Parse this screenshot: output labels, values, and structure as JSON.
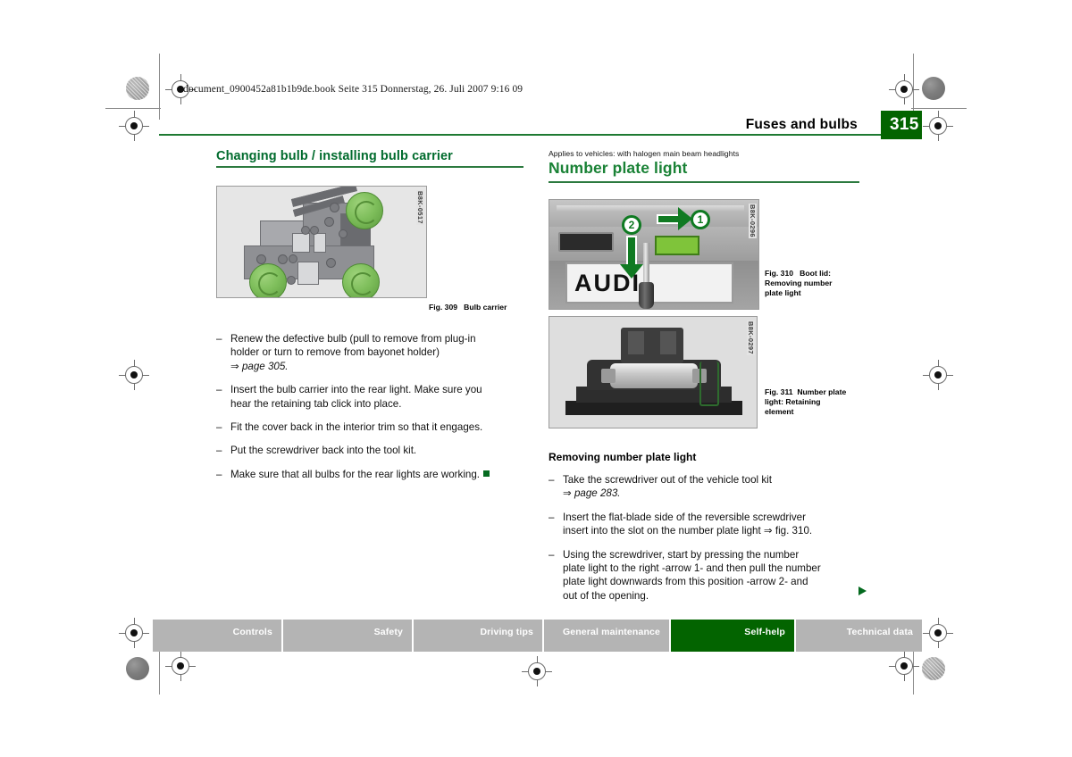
{
  "doc_header": "document_0900452a81b1b9de.book  Seite 315  Donnerstag, 26. Juli 2007  9:16 09",
  "running_head": {
    "title": "Fuses and bulbs",
    "page_number": "315"
  },
  "colors": {
    "green_rule": "#2c7a3f",
    "heading_green": "#1a8236",
    "page_tab_green": "#036400",
    "tab_grey": "#b4b4b4"
  },
  "left_column": {
    "heading": "Changing bulb / installing bulb carrier",
    "figure": {
      "code": "B8K-0517",
      "caption_number": "Fig. 309",
      "caption_text": "Bulb carrier"
    },
    "items": [
      {
        "dash": "–",
        "line1": "Renew the defective bulb (pull to remove from plug-in",
        "line2": "holder or turn to remove from bayonet holder)",
        "ref_arrow": "⇒",
        "ref_text": "page 305.",
        "end_marker": false
      },
      {
        "dash": "–",
        "line1": "Insert the bulb carrier into the rear light. Make sure you",
        "line2": "hear the retaining tab click into place.",
        "ref_arrow": "",
        "ref_text": "",
        "end_marker": false
      },
      {
        "dash": "–",
        "line1": "Fit the cover back in the interior trim so that it engages.",
        "line2": "",
        "ref_arrow": "",
        "ref_text": "",
        "end_marker": false
      },
      {
        "dash": "–",
        "line1": "Put the screwdriver back into the tool kit.",
        "line2": "",
        "ref_arrow": "",
        "ref_text": "",
        "end_marker": false
      },
      {
        "dash": "–",
        "line1": "Make sure that all bulbs for the rear lights are working.",
        "line2": "",
        "ref_arrow": "",
        "ref_text": "",
        "end_marker": true
      }
    ]
  },
  "right_column": {
    "applies_to": "Applies to vehicles: with halogen main beam headlights",
    "heading": "Number plate light",
    "figure_310": {
      "code": "B8K-0296",
      "caption_number": "Fig. 310",
      "caption_line1": "Boot lid:",
      "caption_line2": "Removing number",
      "caption_line3": "plate light",
      "callout_1": "1",
      "callout_2": "2",
      "plate_text": "AUDI"
    },
    "figure_311": {
      "code": "B8K-0297",
      "caption_number": "Fig. 311",
      "caption_line1": "Number plate",
      "caption_line2": "light: Retaining",
      "caption_line3": "element"
    },
    "subheading": "Removing number plate light",
    "items": [
      {
        "dash": "–",
        "line1": "Take the screwdriver out of the vehicle tool kit",
        "line2": "",
        "line3": "",
        "line4": "",
        "ref_arrow": "⇒",
        "ref_text": "page 283."
      },
      {
        "dash": "–",
        "line1": "Insert the flat-blade side of the reversible screwdriver",
        "line2": "insert into the slot on the number plate light ⇒ fig. 310.",
        "line3": "",
        "line4": "",
        "ref_arrow": "",
        "ref_text": ""
      },
      {
        "dash": "–",
        "line1": "Using the screwdriver, start by pressing the number",
        "line2": "plate light to the right -arrow 1- and then pull the number",
        "line3": "plate light downwards from this position -arrow 2- and",
        "line4": "out of the opening.",
        "ref_arrow": "",
        "ref_text": ""
      }
    ]
  },
  "footer_tabs": [
    {
      "label": "Controls",
      "active": false
    },
    {
      "label": "Safety",
      "active": false
    },
    {
      "label": "Driving tips",
      "active": false
    },
    {
      "label": "General maintenance",
      "active": false
    },
    {
      "label": "Self-help",
      "active": true
    },
    {
      "label": "Technical data",
      "active": false
    }
  ]
}
